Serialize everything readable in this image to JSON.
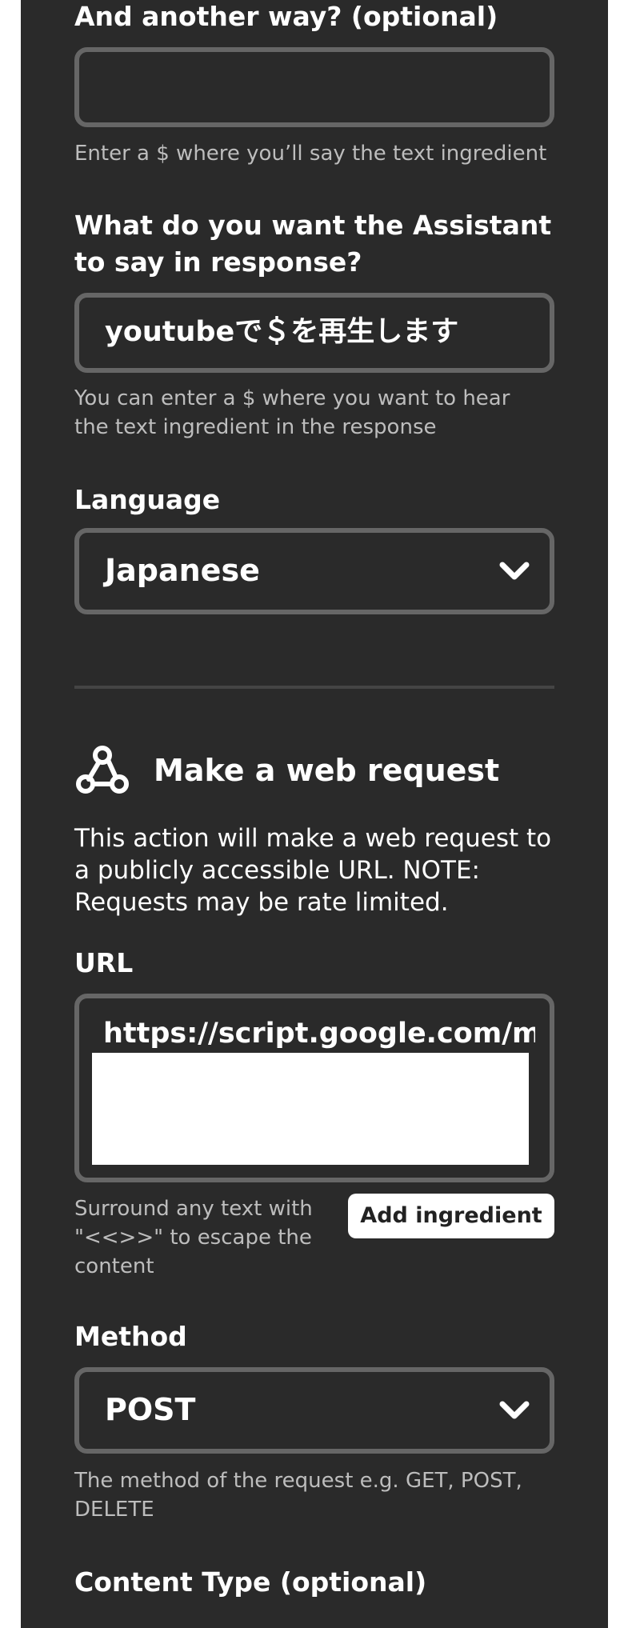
{
  "fields": {
    "another_way": {
      "label": "And another way? (optional)",
      "value": "",
      "help": "Enter a $ where you’ll say the text ingredient"
    },
    "response": {
      "label": "What do you want the Assistant to say in response?",
      "value": "youtubeで＄を再生します",
      "help": "You can enter a $ where you want to hear the text ingredient in the response"
    },
    "language": {
      "label": "Language",
      "selected": "Japanese"
    }
  },
  "web_request": {
    "title": "Make a web request",
    "icon": "webhooks-icon",
    "description": "This action will make a web request to a publicly accessible URL. NOTE: Requests may be rate limited.",
    "url": {
      "label": "URL",
      "value": "https://script.google.com/ma",
      "help": "Surround any text with \"<<>>\" to escape the content",
      "add_ingredient": "Add ingredient"
    },
    "method": {
      "label": "Method",
      "selected": "POST",
      "help": "The method of the request e.g. GET, POST, DELETE"
    },
    "content_type": {
      "label": "Content Type (optional)"
    }
  }
}
